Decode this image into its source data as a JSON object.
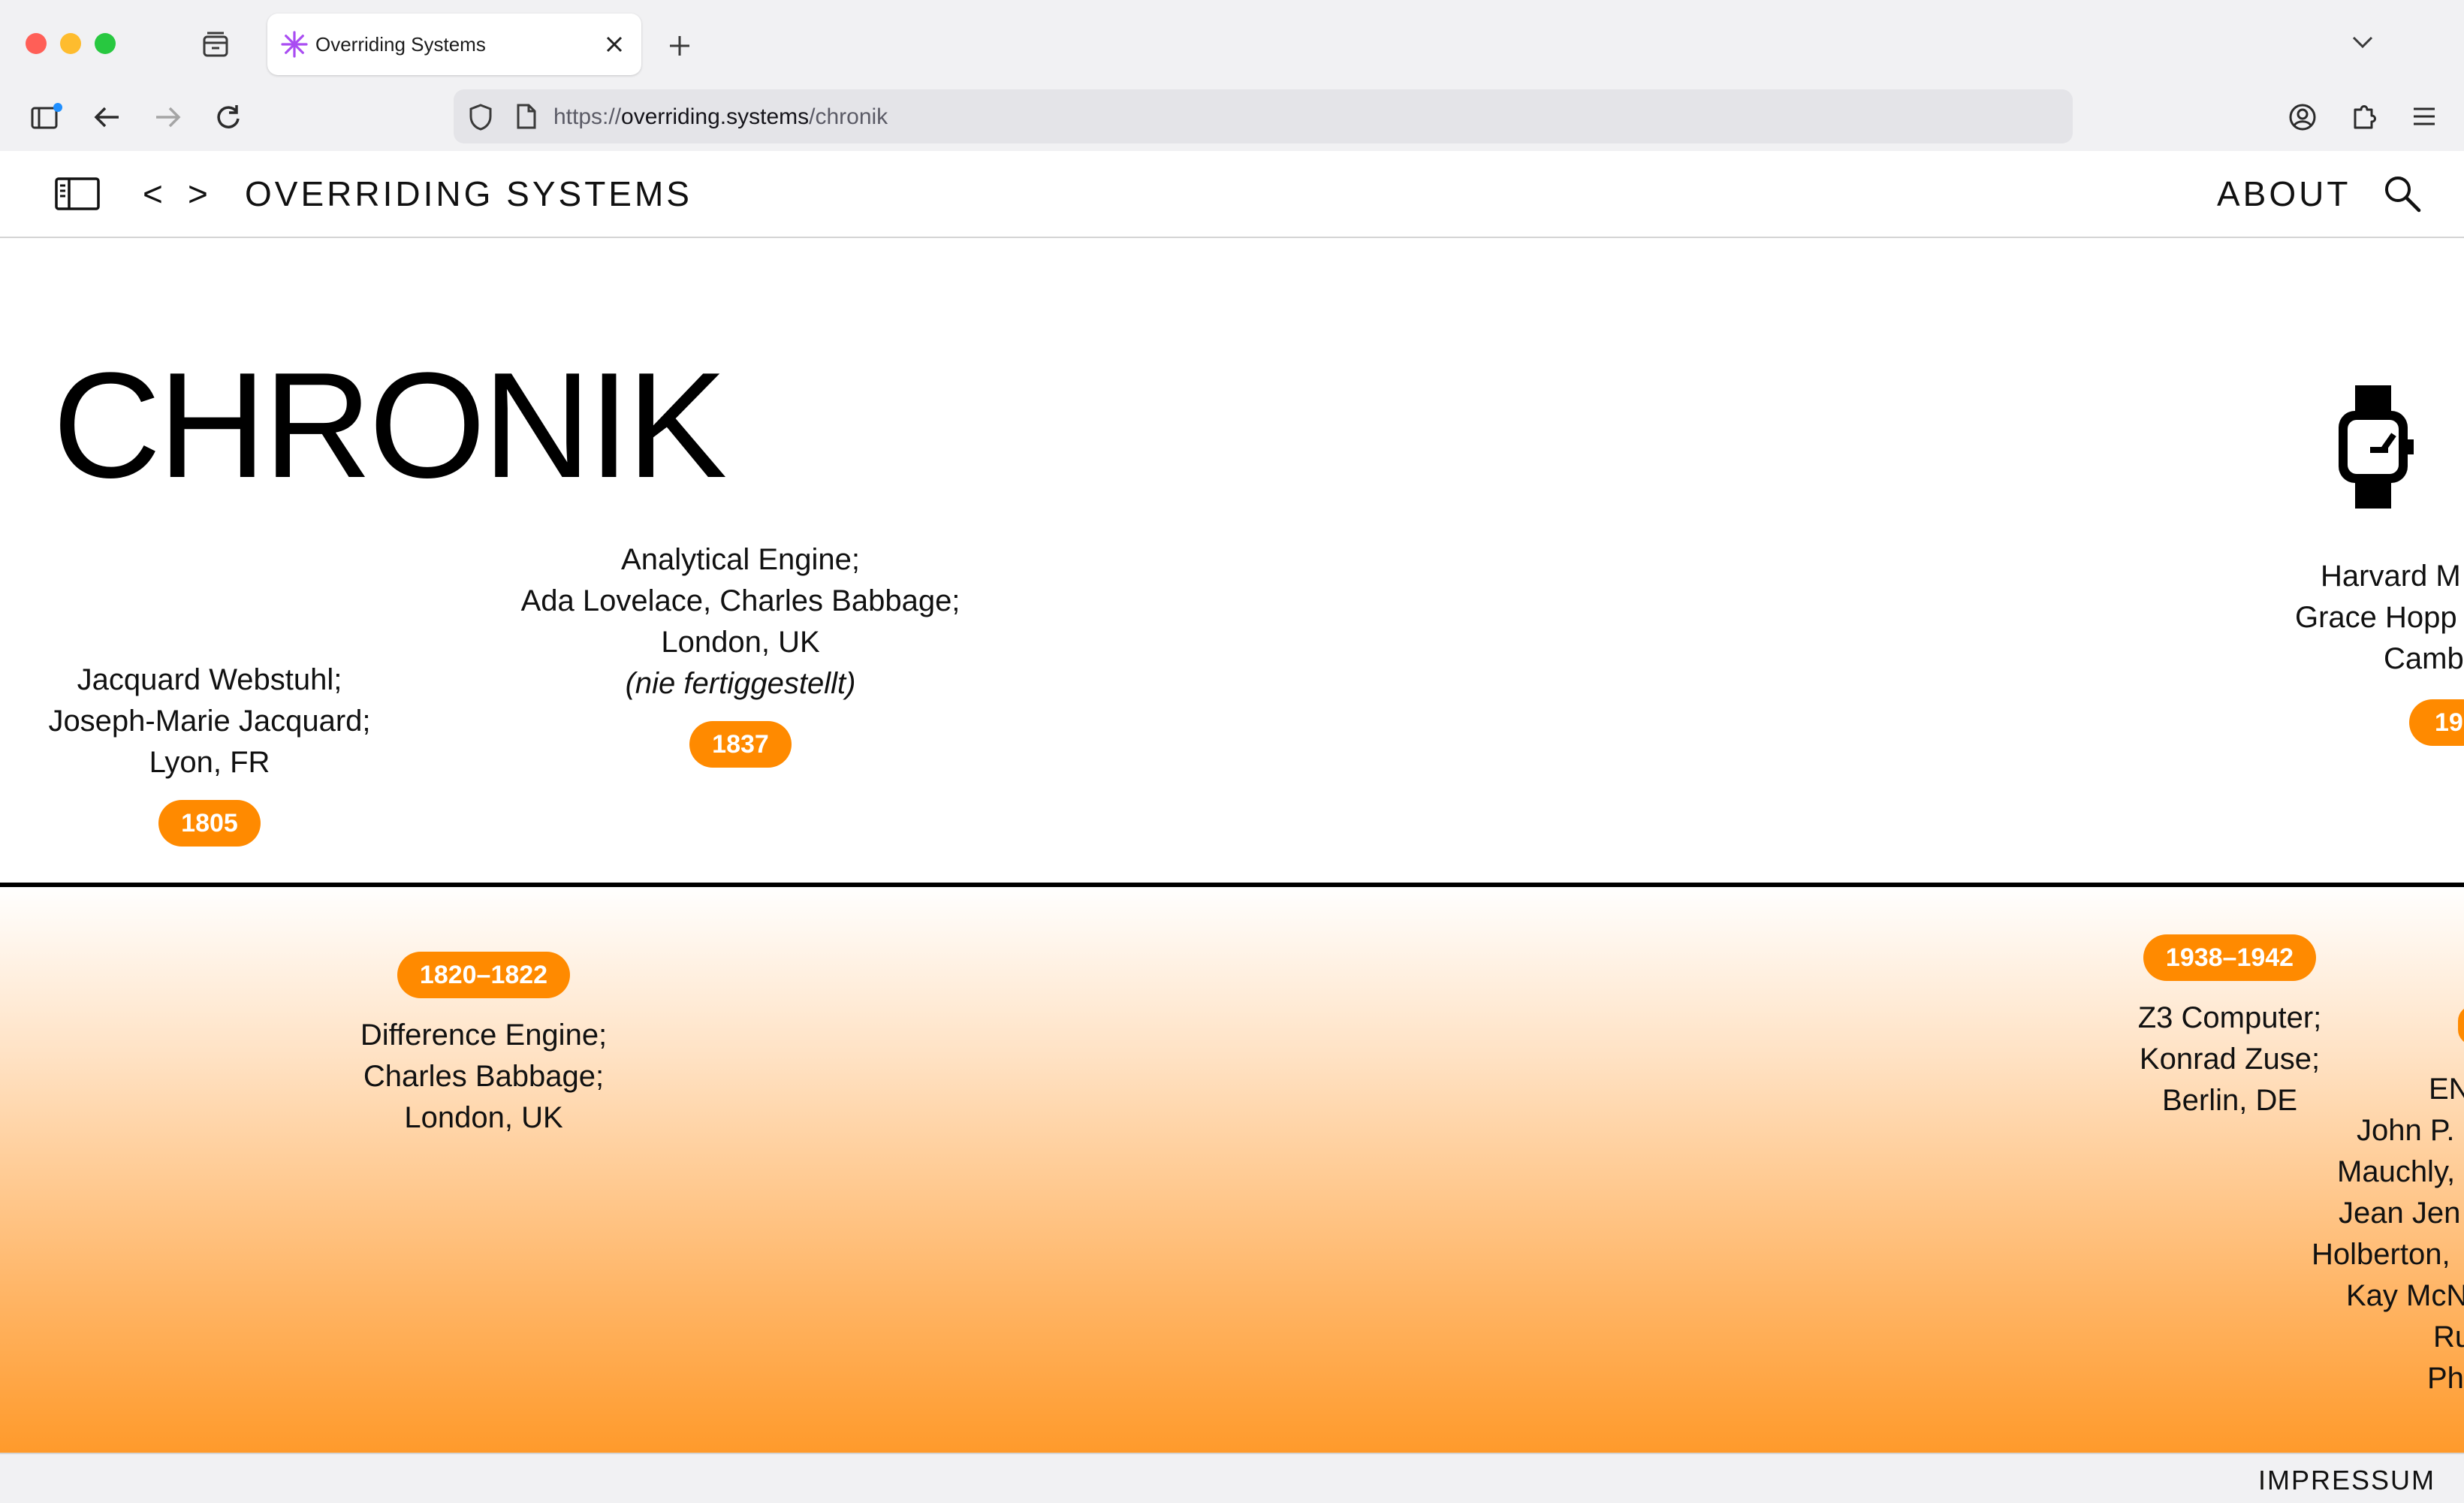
{
  "browser": {
    "tab_title": "Overriding Systems",
    "url_scheme": "https://",
    "url_host": "overriding.systems",
    "url_path": "/chronik",
    "colors": {
      "close": "#ff5f57",
      "minimize": "#febc2e",
      "maximize": "#28c840",
      "tab_icon": "#a94cf2"
    }
  },
  "site": {
    "brand": "OVERRIDING SYSTEMS",
    "nav_prev": "<",
    "nav_next": ">",
    "about": "ABOUT",
    "footer_link": "IMPRESSUM",
    "accent_color": "#ff8a00"
  },
  "page": {
    "title": "CHRONIK"
  },
  "timeline": {
    "above": [
      {
        "year": "1805",
        "lines": [
          "Jacquard Webstuhl;",
          "Joseph-Marie Jacquard;",
          "Lyon, FR"
        ]
      },
      {
        "year": "1837",
        "lines": [
          "Analytical Engine;",
          "Ada Lovelace, Charles Babbage;",
          "London, UK"
        ],
        "note": "(nie fertiggestellt)"
      },
      {
        "year": "19",
        "lines": [
          "Harvard M",
          "Grace Hopp",
          "Camb"
        ],
        "icon": "wristwatch-icon"
      }
    ],
    "below": [
      {
        "year": "1820–1822",
        "lines": [
          "Difference Engine;",
          "Charles Babbage;",
          "London, UK"
        ]
      },
      {
        "year": "1938–1942",
        "lines": [
          "Z3 Computer;",
          "Konrad Zuse;",
          "Berlin, DE"
        ]
      },
      {
        "lines": [
          "EN",
          "John P.",
          "Mauchly,",
          "Jean Jen",
          "Holberton,",
          "Kay McN",
          "Ru",
          "Ph"
        ]
      }
    ]
  }
}
